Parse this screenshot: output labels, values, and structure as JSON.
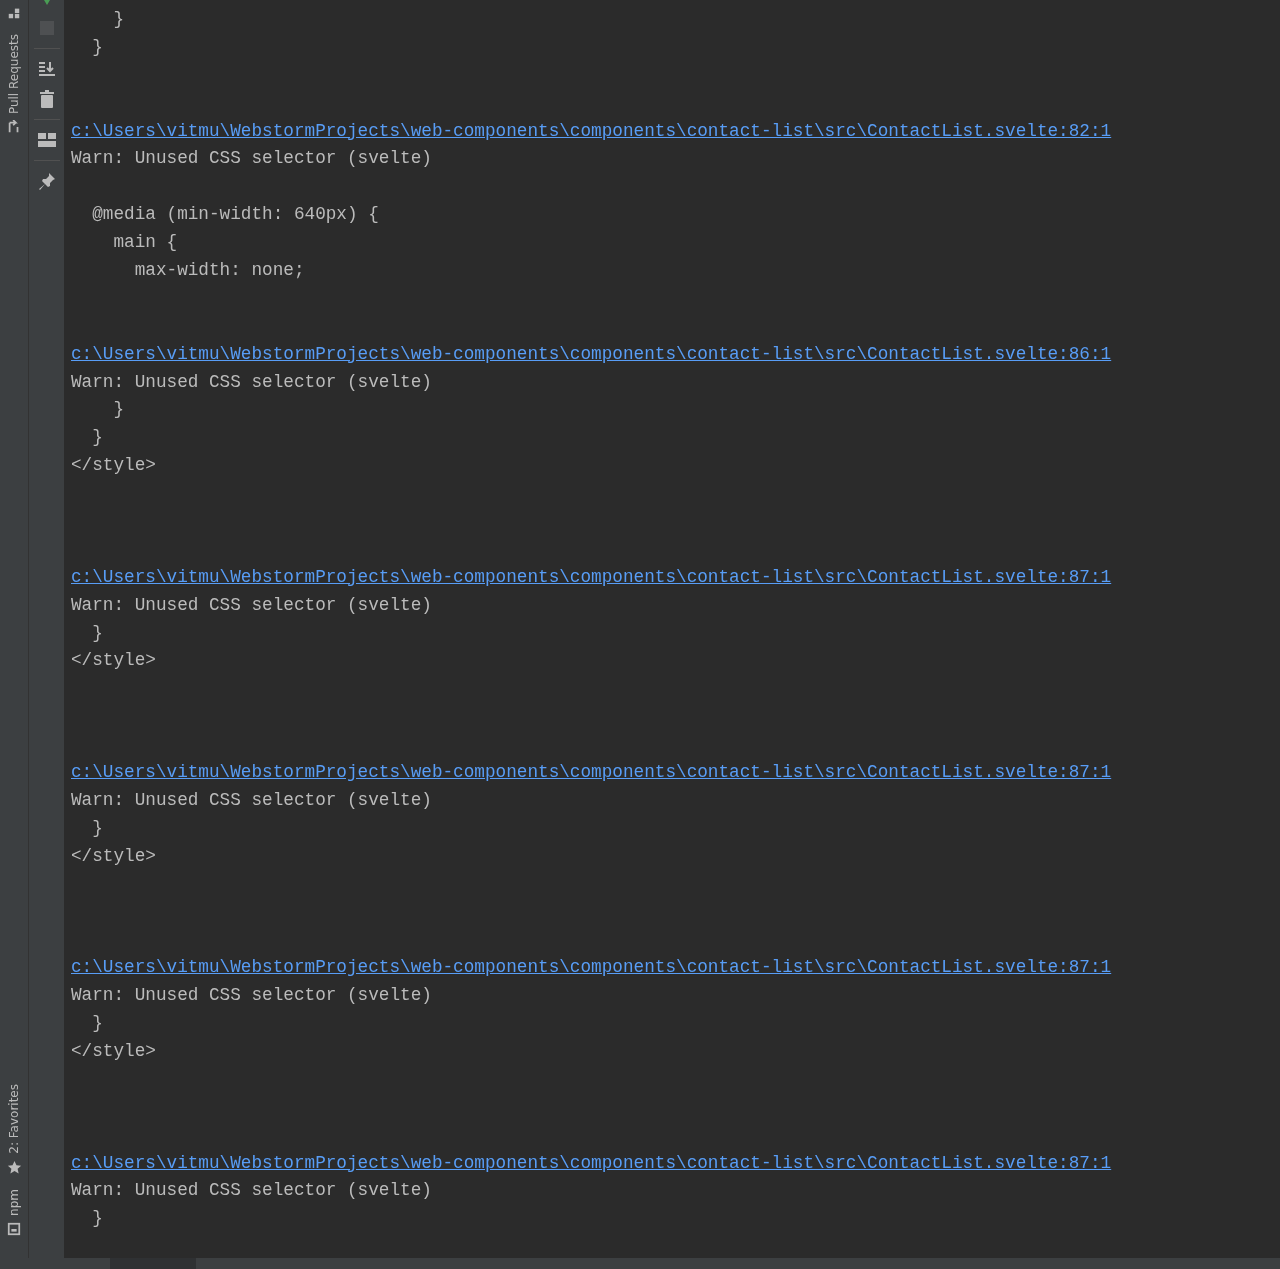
{
  "left_stripe": {
    "top_tabs": [
      {
        "label": "Pull Requests"
      }
    ],
    "bottom_tabs": [
      {
        "label": "2: Favorites",
        "kind": "favorites"
      },
      {
        "label": "npm",
        "kind": "npm"
      }
    ]
  },
  "console": {
    "lines": [
      {
        "kind": "text",
        "text": "    }"
      },
      {
        "kind": "text",
        "text": "  }"
      },
      {
        "kind": "blank"
      },
      {
        "kind": "blank"
      },
      {
        "kind": "link",
        "text": "c:\\Users\\vitmu\\WebstormProjects\\web-components\\components\\contact-list\\src\\ContactList.svelte:82:1"
      },
      {
        "kind": "text",
        "text": "Warn: Unused CSS selector (svelte)"
      },
      {
        "kind": "blank"
      },
      {
        "kind": "text",
        "text": "  @media (min-width: 640px) {"
      },
      {
        "kind": "text",
        "text": "    main {"
      },
      {
        "kind": "text",
        "text": "      max-width: none;"
      },
      {
        "kind": "blank"
      },
      {
        "kind": "blank"
      },
      {
        "kind": "link",
        "text": "c:\\Users\\vitmu\\WebstormProjects\\web-components\\components\\contact-list\\src\\ContactList.svelte:86:1"
      },
      {
        "kind": "text",
        "text": "Warn: Unused CSS selector (svelte)"
      },
      {
        "kind": "text",
        "text": "    }"
      },
      {
        "kind": "text",
        "text": "  }"
      },
      {
        "kind": "text",
        "text": "</style>"
      },
      {
        "kind": "blank"
      },
      {
        "kind": "blank"
      },
      {
        "kind": "blank"
      },
      {
        "kind": "link",
        "text": "c:\\Users\\vitmu\\WebstormProjects\\web-components\\components\\contact-list\\src\\ContactList.svelte:87:1"
      },
      {
        "kind": "text",
        "text": "Warn: Unused CSS selector (svelte)"
      },
      {
        "kind": "text",
        "text": "  }"
      },
      {
        "kind": "text",
        "text": "</style>"
      },
      {
        "kind": "blank"
      },
      {
        "kind": "blank"
      },
      {
        "kind": "blank"
      },
      {
        "kind": "link",
        "text": "c:\\Users\\vitmu\\WebstormProjects\\web-components\\components\\contact-list\\src\\ContactList.svelte:87:1"
      },
      {
        "kind": "text",
        "text": "Warn: Unused CSS selector (svelte)"
      },
      {
        "kind": "text",
        "text": "  }"
      },
      {
        "kind": "text",
        "text": "</style>"
      },
      {
        "kind": "blank"
      },
      {
        "kind": "blank"
      },
      {
        "kind": "blank"
      },
      {
        "kind": "link",
        "text": "c:\\Users\\vitmu\\WebstormProjects\\web-components\\components\\contact-list\\src\\ContactList.svelte:87:1"
      },
      {
        "kind": "text",
        "text": "Warn: Unused CSS selector (svelte)"
      },
      {
        "kind": "text",
        "text": "  }"
      },
      {
        "kind": "text",
        "text": "</style>"
      },
      {
        "kind": "blank"
      },
      {
        "kind": "blank"
      },
      {
        "kind": "blank"
      },
      {
        "kind": "link",
        "text": "c:\\Users\\vitmu\\WebstormProjects\\web-components\\components\\contact-list\\src\\ContactList.svelte:87:1"
      },
      {
        "kind": "text",
        "text": "Warn: Unused CSS selector (svelte)"
      },
      {
        "kind": "text",
        "text": "  }"
      }
    ]
  }
}
